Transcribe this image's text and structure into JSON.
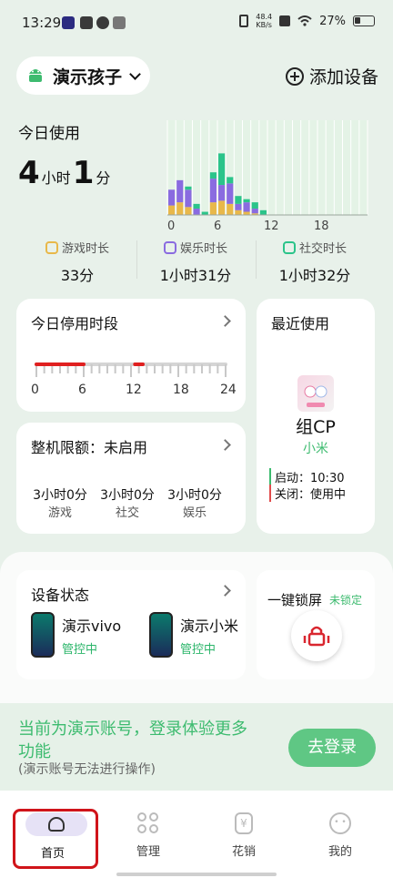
{
  "status_bar": {
    "time": "13:29",
    "net_speed_value": "48.4",
    "net_speed_unit": "KB/s",
    "battery": "27%"
  },
  "header": {
    "child_name": "演示孩子",
    "add_device": "添加设备"
  },
  "usage": {
    "title": "今日使用",
    "hours": "4",
    "hours_unit": "小时",
    "minutes": "1",
    "minutes_unit": "分",
    "chart_ticks": [
      "0",
      "6",
      "12",
      "18"
    ],
    "categories": [
      {
        "label": "游戏时长",
        "value": "33分",
        "color": "#e8b84a"
      },
      {
        "label": "娱乐时长",
        "value": "1小时31分",
        "color": "#8a6be0"
      },
      {
        "label": "社交时长",
        "value": "1小时32分",
        "color": "#2bc48a"
      }
    ]
  },
  "chart_data": {
    "type": "bar",
    "x": [
      0,
      1,
      2,
      3,
      4,
      5,
      6,
      7,
      8,
      9,
      10,
      11,
      12,
      13,
      14,
      15,
      16,
      17,
      18,
      19,
      20,
      21,
      22,
      23
    ],
    "series": [
      {
        "name": "游戏时长",
        "values": [
          6,
          8,
          5,
          0,
          0,
          8,
          9,
          7,
          3,
          2,
          1,
          0,
          0,
          0,
          0,
          0,
          0,
          0,
          0,
          0,
          0,
          0,
          0,
          0
        ]
      },
      {
        "name": "娱乐时长",
        "values": [
          10,
          14,
          11,
          4,
          0,
          15,
          10,
          13,
          4,
          6,
          3,
          0,
          0,
          0,
          0,
          0,
          0,
          0,
          0,
          0,
          0,
          0,
          0,
          0
        ]
      },
      {
        "name": "社交时长",
        "values": [
          0,
          0,
          2,
          3,
          2,
          4,
          20,
          4,
          5,
          2,
          4,
          3,
          0,
          0,
          0,
          0,
          0,
          0,
          0,
          0,
          0,
          0,
          0,
          0
        ]
      }
    ],
    "ylim": [
      0,
      60
    ],
    "grid": true
  },
  "downtime": {
    "title": "今日停用时段",
    "ticks": [
      "0",
      "6",
      "12",
      "18",
      "24"
    ],
    "periods_hours": [
      [
        0,
        6
      ],
      [
        12.5,
        13.5
      ]
    ],
    "accent": "#e02020"
  },
  "recent": {
    "title": "最近使用",
    "app_name": "组CP",
    "brand": "小米",
    "start_label": "启动：",
    "start_value": "10:30",
    "close_label": "关闭：",
    "close_value": "使用中"
  },
  "quota": {
    "title": "整机限额：未启用",
    "items": [
      {
        "value": "3小时0分",
        "label": "游戏"
      },
      {
        "value": "3小时0分",
        "label": "社交"
      },
      {
        "value": "3小时0分",
        "label": "娱乐"
      }
    ]
  },
  "device_status": {
    "title": "设备状态",
    "devices": [
      {
        "name": "演示vivo",
        "status": "管控中"
      },
      {
        "name": "演示小米",
        "status": "管控中"
      }
    ]
  },
  "lock": {
    "title": "一键锁屏",
    "status": "未锁定"
  },
  "login_banner": {
    "line1": "当前为演示账号，登录体验更多",
    "line2": "功能",
    "note": "(演示账号无法进行操作)",
    "button": "去登录"
  },
  "tabs": [
    {
      "label": "首页"
    },
    {
      "label": "管理"
    },
    {
      "label": "花销"
    },
    {
      "label": "我的"
    }
  ],
  "colors": {
    "accent_green": "#3dbb6f",
    "highlight_red": "#d9262f"
  }
}
